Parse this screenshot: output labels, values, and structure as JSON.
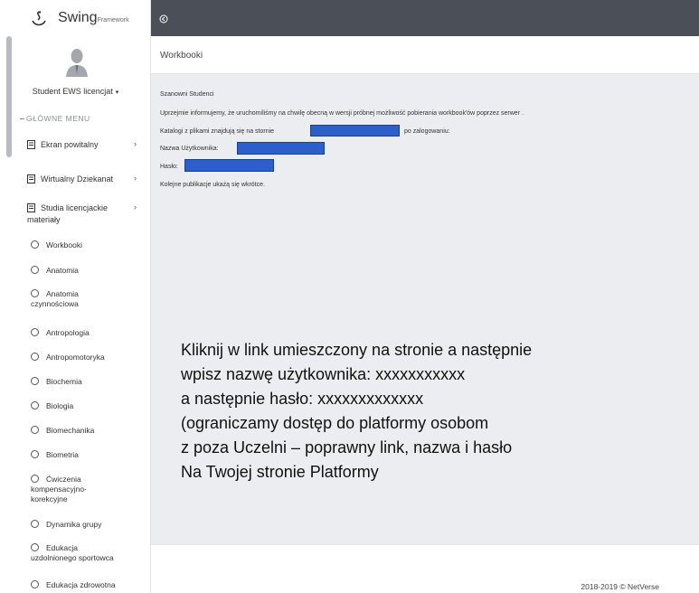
{
  "brand": {
    "name": "Swing",
    "sub": "Framework"
  },
  "user": {
    "name": "Student EWS licencjat",
    "caret": "▾"
  },
  "sidebar": {
    "menu_header": "GŁÓWNE MENU",
    "items": [
      {
        "label": "Ekran powitalny",
        "chevron": "›"
      },
      {
        "label": "Wirtualny Dziekanat",
        "chevron": "›"
      },
      {
        "label": "Studia licencjackie",
        "label2": "materiały",
        "chevron": "›"
      }
    ],
    "subitems": [
      {
        "label": "Workbooki"
      },
      {
        "label": "Anatomia"
      },
      {
        "label": "Anatomia",
        "label2": "czynnościowa"
      },
      {
        "label": "Antropologia"
      },
      {
        "label": "Antropomotoryka"
      },
      {
        "label": "Biochemia"
      },
      {
        "label": "Biologia"
      },
      {
        "label": "Biomechanika"
      },
      {
        "label": "Biometria"
      },
      {
        "label": "Ćwiczenia",
        "label2": "kompensacyjno-",
        "label3": "korekcyjne"
      },
      {
        "label": "Dynamika grupy"
      },
      {
        "label": "Edukacja",
        "label2": "uzdolnionego sportowca"
      },
      {
        "label": "Edukacja zdrowotna"
      }
    ]
  },
  "page": {
    "title": "Workbooki"
  },
  "content": {
    "greeting": "Szanowni Studenci",
    "line1": "Uprzejmie informujemy, że uruchomiliśmy na chwilę obecną w wersji próbnej możliwość pobierania workbook'ów poprzez serwer .",
    "line2_pre": "Katalogi z plikami znajdują się na stornie",
    "line2_post": "po zalogowaniu:",
    "username_label": "Nazwa Użytkownika:",
    "password_label": "Hasło:",
    "closing": "Kolejne publikacje ukażą się wkrótce."
  },
  "overlay": {
    "lines": [
      "Kliknij w link umieszczony na stronie a następnie",
      "wpisz nazwę użytkownika: xxxxxxxxxxx",
      "a następnie hasło: xxxxxxxxxxxxx",
      "(ograniczamy dostęp do platformy osobom",
      "z poza Uczelni – poprawny link, nazwa i hasło",
      "Na Twojej stronie Platformy"
    ]
  },
  "footer": {
    "text": "2018-2019 © NetVerse"
  },
  "colors": {
    "topbar": "#4b5058",
    "content_bg": "#ecedf0",
    "redaction": "#2c5fc9"
  },
  "icons": {
    "logo": "swing-logo-icon",
    "collapse": "collapse-toggle-icon",
    "menu": "document-icon",
    "sub": "circle-icon"
  }
}
